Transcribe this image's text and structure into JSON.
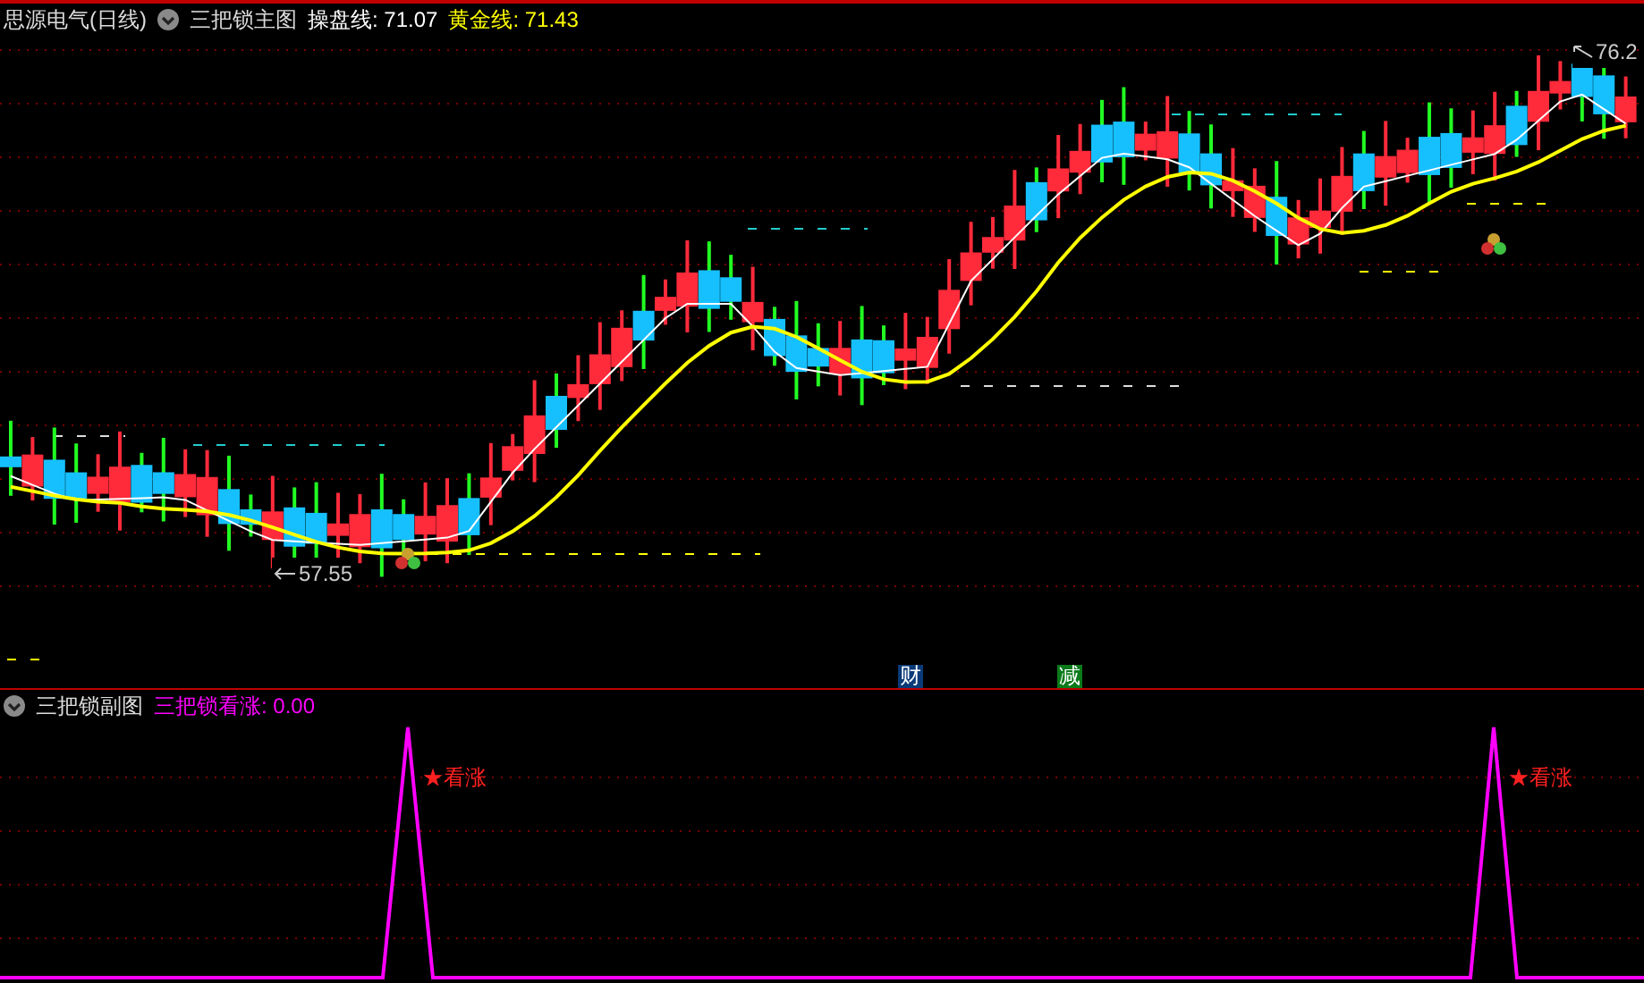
{
  "header": {
    "stock": "思源电气(日线)",
    "indicator": "三把锁主图",
    "lines": [
      {
        "label": "操盘线: 71.07",
        "color": "#ffffff"
      },
      {
        "label": "黄金线: 71.43",
        "color": "#ffff00"
      }
    ]
  },
  "main_chart": {
    "high_label": "76.2",
    "low_label": "57.55",
    "markers": [
      {
        "text": "财",
        "color": "#0a3a78"
      },
      {
        "text": "减",
        "color": "#0a7a1a"
      }
    ]
  },
  "sub_panel": {
    "indicator": "三把锁副图",
    "reading": "三把锁看涨: 0.00",
    "signals": [
      "★看涨",
      "★看涨"
    ]
  }
}
